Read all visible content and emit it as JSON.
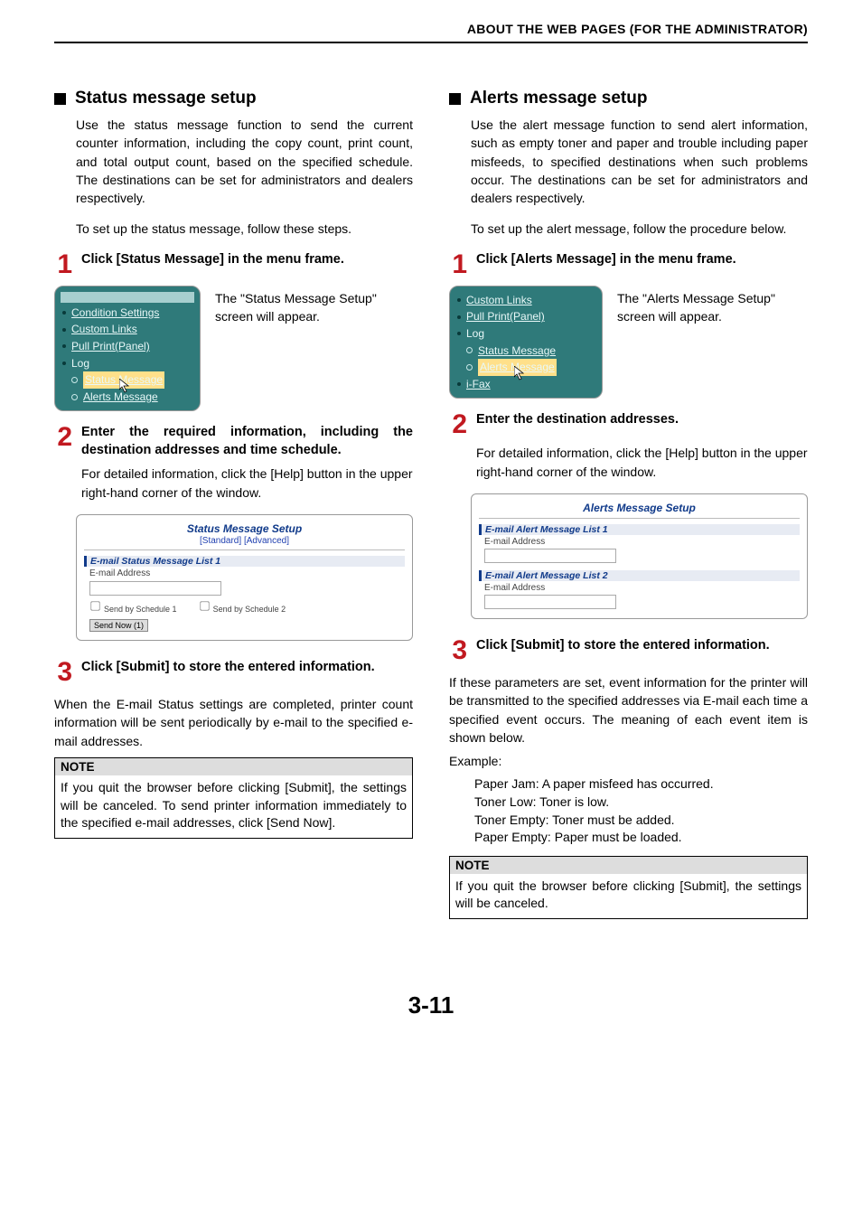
{
  "header": "ABOUT THE WEB PAGES (FOR THE ADMINISTRATOR)",
  "page_number": "3-11",
  "left": {
    "title": "Status message setup",
    "intro": "Use the status message function to send the current counter information, including the copy count, print count, and total output count, based on the specified schedule. The destinations can be set for administrators and dealers respectively.",
    "intro2": "To set up the status message, follow these steps.",
    "step1": {
      "num": "1",
      "title": "Click [Status Message] in the menu frame.",
      "menu": {
        "items": [
          "Condition Settings",
          "Custom Links",
          "Pull Print(Panel)",
          "Log",
          "Status Message",
          "Alerts Message"
        ]
      },
      "caption": "The \"Status Message Setup\" screen will appear."
    },
    "step2": {
      "num": "2",
      "title": "Enter the required information, including the destination addresses and time schedule.",
      "detail": "For detailed information, click the [Help] button in the upper right-hand corner of the window.",
      "shot": {
        "title": "Status Message Setup",
        "tabs": [
          "[Standard]",
          "[Advanced]"
        ],
        "group": "E-mail Status Message List 1",
        "label": "E-mail Address",
        "chk1": "Send by Schedule 1",
        "chk2": "Send by Schedule 2",
        "btn": "Send Now (1)"
      }
    },
    "step3": {
      "num": "3",
      "title": "Click [Submit] to store the entered information."
    },
    "aftersteps": "When the E-mail Status settings are completed, printer count information will be sent periodically by e-mail to the specified e-mail addresses.",
    "note": {
      "head": "NOTE",
      "body": "If you quit the browser before clicking [Submit], the settings will be canceled. To send printer information immediately to the specified e-mail addresses, click [Send Now]."
    }
  },
  "right": {
    "title": "Alerts message setup",
    "intro": "Use the alert message function to send alert information, such as empty toner and paper and trouble including paper misfeeds, to specified destinations when such problems occur. The destinations can be set for administrators and dealers respectively.",
    "intro2": "To set up the alert message, follow the procedure below.",
    "step1": {
      "num": "1",
      "title": "Click [Alerts Message] in the menu frame.",
      "menu": {
        "items": [
          "Custom Links",
          "Pull Print(Panel)",
          "Log",
          "Status Message",
          "Alerts Message",
          "i-Fax"
        ]
      },
      "caption": "The \"Alerts Message Setup\" screen will appear."
    },
    "step2": {
      "num": "2",
      "title": "Enter the destination addresses.",
      "detail": "For detailed information, click the [Help] button in the upper right-hand corner of the window.",
      "shot": {
        "title": "Alerts Message Setup",
        "group1": "E-mail Alert Message List 1",
        "group2": "E-mail Alert Message List 2",
        "label": "E-mail Address"
      }
    },
    "step3": {
      "num": "3",
      "title": "Click [Submit] to store the entered information."
    },
    "aftersteps": "If these parameters are set, event information for the printer will be transmitted to the specified addresses via E-mail each time a specified event occurs. The meaning of each event item is shown below.",
    "example_label": "Example:",
    "examples": [
      "Paper Jam: A paper misfeed has occurred.",
      "Toner Low: Toner is low.",
      "Toner Empty: Toner must be added.",
      "Paper Empty: Paper must be loaded."
    ],
    "note": {
      "head": "NOTE",
      "body": "If you quit the browser before clicking [Submit], the settings will be canceled."
    }
  }
}
